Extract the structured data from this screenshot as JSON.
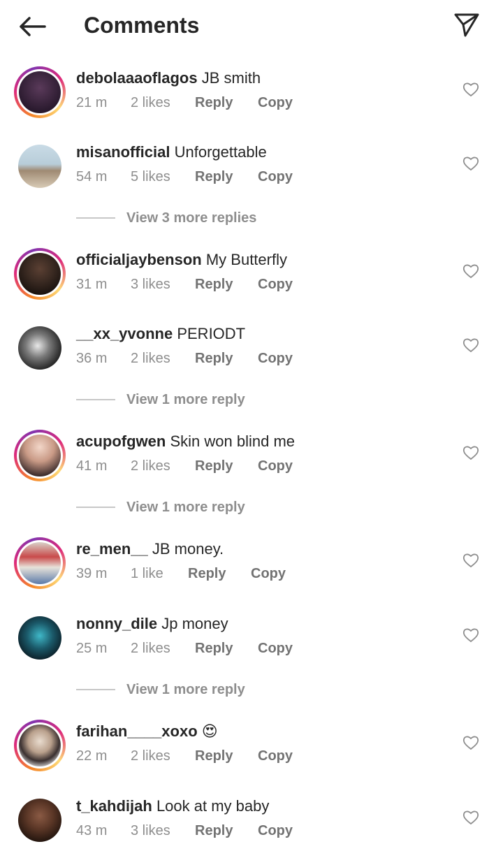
{
  "header": {
    "title": "Comments",
    "back_icon": "arrow-left-icon",
    "send_icon": "paper-plane-icon"
  },
  "colors": {
    "text": "#262626",
    "muted": "#8e8e8e",
    "ring_start": "#f58529",
    "ring_end": "#dd2a7b"
  },
  "comments": [
    {
      "username": "debolaaaoflagos",
      "text": "JB smith",
      "time": "21 m",
      "likes": "2 likes",
      "reply": "Reply",
      "copy": "Copy",
      "ring": true
    },
    {
      "username": "misanofficial",
      "text": "Unforgettable",
      "time": "54 m",
      "likes": "5 likes",
      "reply": "Reply",
      "copy": "Copy",
      "ring": false
    },
    {
      "username": "officialjaybenson",
      "text": "My Butterfly",
      "time": "31 m",
      "likes": "3 likes",
      "reply": "Reply",
      "copy": "Copy",
      "ring": true
    },
    {
      "username": "__xx_yvonne",
      "text": "PERIODT",
      "time": "36 m",
      "likes": "2 likes",
      "reply": "Reply",
      "copy": "Copy",
      "ring": false
    },
    {
      "username": "acupofgwen",
      "text": "Skin won blind me",
      "time": "41 m",
      "likes": "2 likes",
      "reply": "Reply",
      "copy": "Copy",
      "ring": true
    },
    {
      "username": "re_men__",
      "text": "JB money.",
      "time": "39 m",
      "likes": "1 like",
      "reply": "Reply",
      "copy": "Copy",
      "ring": true
    },
    {
      "username": "nonny_dile",
      "text": "Jp money",
      "time": "25 m",
      "likes": "2 likes",
      "reply": "Reply",
      "copy": "Copy",
      "ring": false
    },
    {
      "username": "farihan____xoxo",
      "text": "😍",
      "time": "22 m",
      "likes": "2 likes",
      "reply": "Reply",
      "copy": "Copy",
      "ring": true
    },
    {
      "username": "t_kahdijah",
      "text": "Look at my baby",
      "time": "43 m",
      "likes": "3 likes",
      "reply": "Reply",
      "copy": "Copy",
      "ring": false
    }
  ],
  "view_replies": [
    {
      "label": "View 3 more replies"
    },
    {
      "label": "View 1 more reply"
    },
    {
      "label": "View 1 more reply"
    },
    {
      "label": "View 1 more reply"
    }
  ]
}
